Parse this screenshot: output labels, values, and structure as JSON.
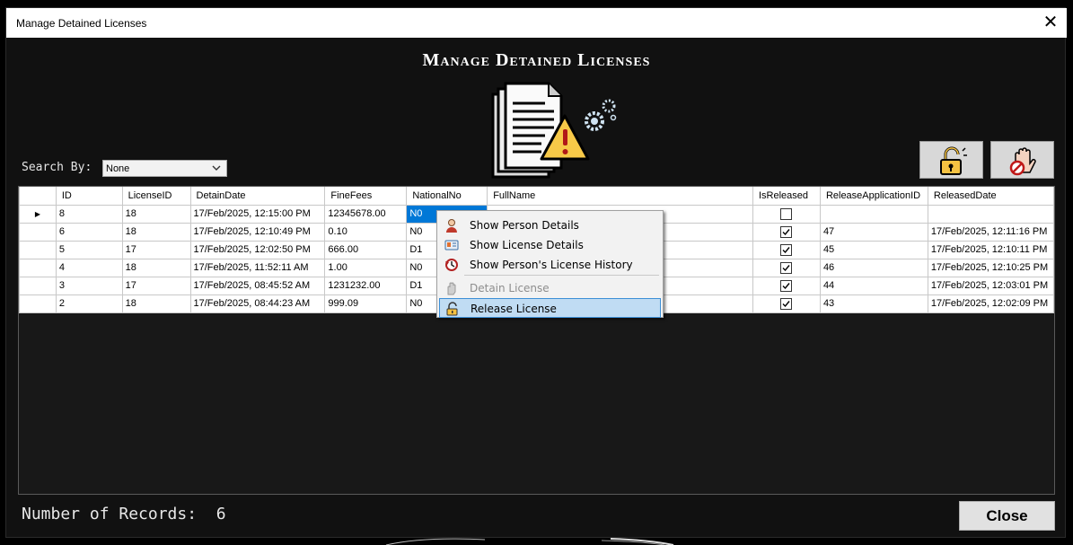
{
  "window": {
    "title": "Manage Detained Licenses",
    "close_glyph": "✕"
  },
  "heading": "Manage Detained Licenses",
  "search": {
    "label": "Search By:",
    "selected": "None"
  },
  "toolbar": {
    "release_icon": "unlock-icon",
    "detain_icon": "stop-hand-icon"
  },
  "table": {
    "columns": [
      "ID",
      "LicenseID",
      "DetainDate",
      "FineFees",
      "NationalNo",
      "FullName",
      "IsReleased",
      "ReleaseApplicationID",
      "ReleasedDate"
    ],
    "rows": [
      {
        "id": "8",
        "license_id": "18",
        "detain_date": "17/Feb/2025, 12:15:00 PM",
        "fine_fees": "12345678.00",
        "national_no": "N0",
        "full_name": "",
        "is_released": false,
        "release_app_id": "",
        "released_date": ""
      },
      {
        "id": "6",
        "license_id": "18",
        "detain_date": "17/Feb/2025, 12:10:49 PM",
        "fine_fees": "0.10",
        "national_no": "N0",
        "full_name": "",
        "is_released": true,
        "release_app_id": "47",
        "released_date": "17/Feb/2025, 12:11:16 PM"
      },
      {
        "id": "5",
        "license_id": "17",
        "detain_date": "17/Feb/2025, 12:02:50 PM",
        "fine_fees": "666.00",
        "national_no": "D1",
        "full_name": "",
        "is_released": true,
        "release_app_id": "45",
        "released_date": "17/Feb/2025, 12:10:11 PM"
      },
      {
        "id": "4",
        "license_id": "18",
        "detain_date": "17/Feb/2025, 11:52:11 AM",
        "fine_fees": "1.00",
        "national_no": "N0",
        "full_name": "",
        "is_released": true,
        "release_app_id": "46",
        "released_date": "17/Feb/2025, 12:10:25 PM"
      },
      {
        "id": "3",
        "license_id": "17",
        "detain_date": "17/Feb/2025, 08:45:52 AM",
        "fine_fees": "1231232.00",
        "national_no": "D1",
        "full_name": "",
        "is_released": true,
        "release_app_id": "44",
        "released_date": "17/Feb/2025, 12:03:01 PM"
      },
      {
        "id": "2",
        "license_id": "18",
        "detain_date": "17/Feb/2025, 08:44:23 AM",
        "fine_fees": "999.09",
        "national_no": "N0",
        "full_name": "",
        "is_released": true,
        "release_app_id": "43",
        "released_date": "17/Feb/2025, 12:02:09 PM"
      }
    ],
    "current_row_marker": "▶"
  },
  "context_menu": {
    "items": [
      {
        "label": "Show Person Details",
        "icon": "person-icon",
        "enabled": true
      },
      {
        "label": "Show License Details",
        "icon": "license-card-icon",
        "enabled": true
      },
      {
        "label": "Show Person's License History",
        "icon": "history-icon",
        "enabled": true
      },
      {
        "label": "Detain License",
        "icon": "detain-hand-icon",
        "enabled": false
      },
      {
        "label": "Release License",
        "icon": "unlock-icon",
        "enabled": true,
        "highlighted": true
      }
    ]
  },
  "footer": {
    "records_label": "Number of Records:",
    "records_count": "6",
    "close_label": "Close"
  },
  "colors": {
    "background": "#111111",
    "selection": "#0078d7",
    "menu_highlight": "#c0dcf3"
  }
}
